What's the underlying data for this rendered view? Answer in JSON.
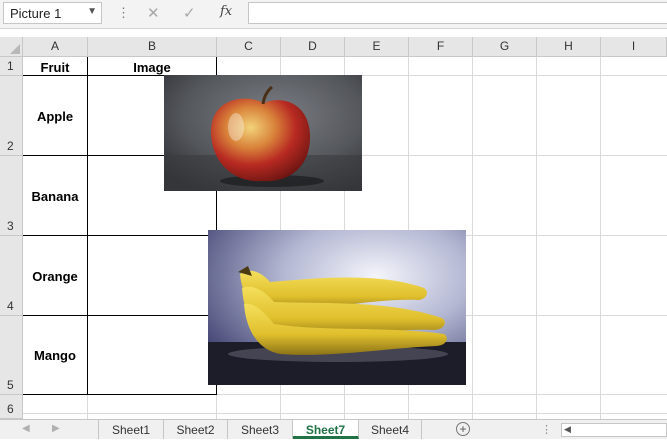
{
  "formula_bar": {
    "name_box": "Picture 1",
    "name_box_arrow": "▼",
    "dots": "⋮",
    "cancel_icon": "✕",
    "enter_icon": "✓",
    "fx_label": "fx",
    "formula": ""
  },
  "columns": [
    "A",
    "B",
    "C",
    "D",
    "E",
    "F",
    "G",
    "H",
    "I"
  ],
  "rows": [
    "1",
    "2",
    "3",
    "4",
    "5",
    "6"
  ],
  "cells": {
    "a1": "Fruit",
    "b1": "Image",
    "a2": "Apple",
    "a3": "Banana",
    "a4": "Orange",
    "a5": "Mango"
  },
  "pictures": {
    "apple": "apple-photo",
    "banana": "banana-photo"
  },
  "sheet_tabs": [
    "Sheet1",
    "Sheet2",
    "Sheet3",
    "Sheet7",
    "Sheet4"
  ],
  "active_tab": "Sheet7",
  "nav": {
    "prev": "◀",
    "next": "▶",
    "add": "+",
    "more": "⋮",
    "scroll_left": "◀"
  },
  "colors": {
    "accent": "#217346",
    "header_bg": "#e6e6e6",
    "gridline": "#dadada"
  }
}
